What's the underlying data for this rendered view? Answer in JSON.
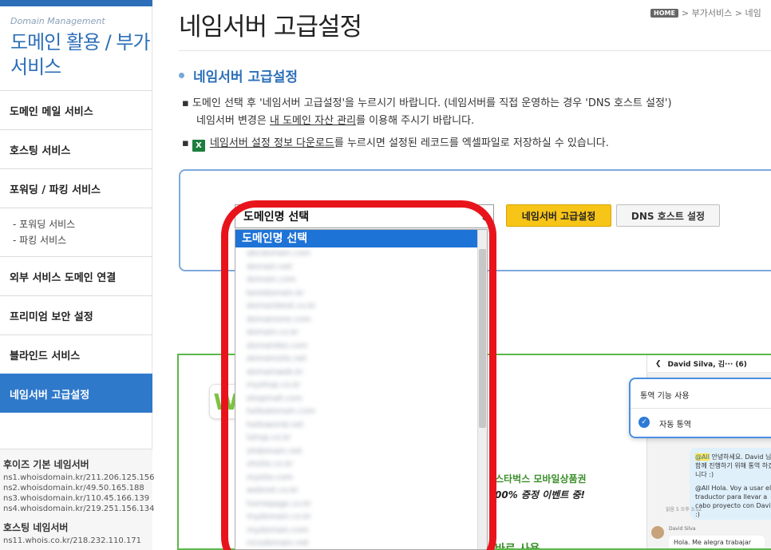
{
  "sidebar": {
    "subtitle": "Domain Management",
    "title": "도메인 활용 / 부가서비스",
    "items": [
      {
        "label": "도메인 메일 서비스"
      },
      {
        "label": "호스팅 서비스"
      },
      {
        "label": "포워딩 / 파킹 서비스"
      },
      {
        "label": "외부 서비스 도메인 연결"
      },
      {
        "label": "프리미엄 보안 설정"
      },
      {
        "label": "블라인드 서비스"
      },
      {
        "label": "네임서버 고급설정"
      }
    ],
    "sub_items": [
      "- 포워딩 서비스",
      "- 파킹 서비스"
    ],
    "ns_heading": "후이즈 기본 네임서버",
    "ns_lines": [
      "ns1.whoisdomain.kr/211.206.125.156",
      "ns2.whoisdomain.kr/49.50.165.188",
      "ns3.whoisdomain.kr/110.45.166.139",
      "ns4.whoisdomain.kr/219.251.156.134"
    ],
    "ns_heading2": "호스팅 네임서버",
    "ns_line_partial": "ns11.whois.co.kr/218.232.110.171"
  },
  "header": {
    "title": "네임서버 고급설정",
    "breadcrumb_home": "HOME",
    "breadcrumb": "> 부가서비스 > 네임"
  },
  "section": {
    "title": "네임서버 고급설정",
    "desc1_pre": "▪ 도메인 선택 후 '네임서버 고급설정'을 누르시기 바랍니다. (네임서버를 직접 운영하는 경우 'DNS 호스트 설정')",
    "desc2_pre": "네임서버 변경은 ",
    "desc2_link": "내 도메인 자산 관리",
    "desc2_post": "를 이용해 주시기 바랍니다.",
    "desc3_link": "네임서버 설정 정보 다운로드",
    "desc3_post": "를 누르시면 설정된 레코드를 엑셀파일로 저장하실 수 있습니다.",
    "bullet": "▪"
  },
  "controls": {
    "select_value": "도메인명 선택",
    "dropdown_selected": "도메인명 선택",
    "dropdown_items": [
      "abcdomain.com",
      "domain.net",
      "domain.com",
      "bestdomain.kr",
      "domainbest.co.kr",
      "domainone.com",
      "domain.co.kr",
      "domainbiz.com",
      "domainsite.net",
      "domainweb.kr",
      "myshop.co.kr",
      "shopmall.com",
      "hellodomain.com",
      "helloworld.net",
      "tshop.co.kr",
      "ohdomain.net",
      "ohsite.co.kr",
      "mysite.com",
      "webnet.co.kr",
      "homepage.co.kr",
      "mydomain.co.kr",
      "mydomain.com",
      "nicedomain.net"
    ],
    "btn_advanced": "네임서버 고급설정",
    "btn_dns": "DNS 호스트 설정"
  },
  "banner": {
    "logo": "W",
    "promo1": "스타벅스 모바일상품권",
    "promo2": "00% 증정 이벤트 중!",
    "promo3": "바로 사용",
    "chat_title": "David Silva, 김··· (6)",
    "card_row1": "통역 기능 사용",
    "card_row2": "자동 통역",
    "bubble_tag": "@All",
    "bubble_text1": " 안녕하세요. David 님을 함께 진행하기 위해 통역 하겠습니다 :)",
    "bubble_text2": "@All Hola. Voy a usar el traductor para llevar a cabo proyecto con David :)",
    "bubble_time": "읽음 5 오후 3:52",
    "reply_name": "David Silva",
    "reply_text": "Hola. Me alegra trabajar"
  },
  "colors": {
    "accent": "#2c6fb8",
    "active_menu": "#2f79cb",
    "yellow_button": "#f7c418",
    "highlight_ring": "#e8141c",
    "banner_border": "#5ab84a"
  }
}
